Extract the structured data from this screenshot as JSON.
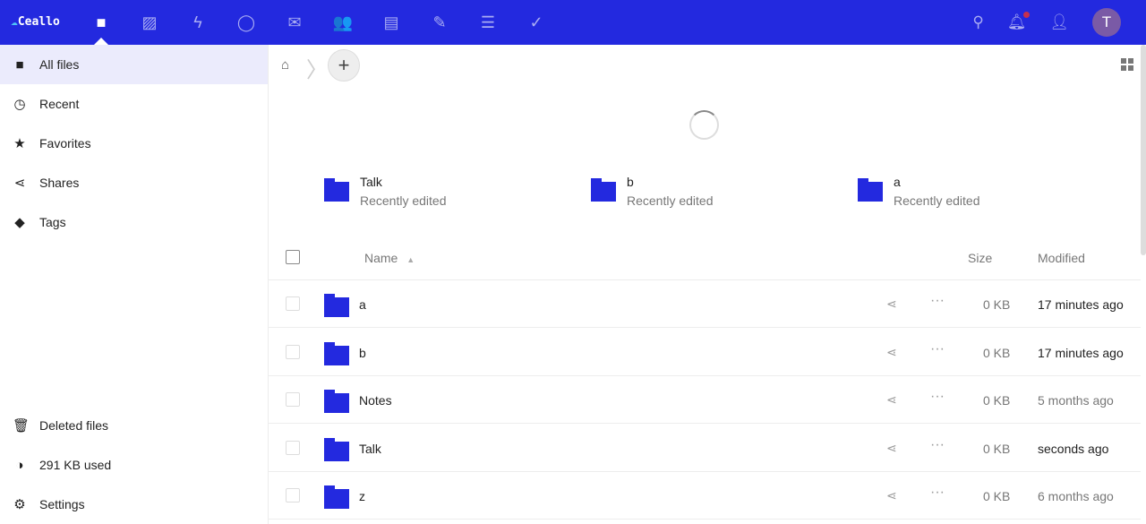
{
  "header": {
    "logo": "Ceallo",
    "apps": [
      {
        "icon": "files-icon",
        "glyph": "■",
        "active": true
      },
      {
        "icon": "photos-icon",
        "glyph": "▨"
      },
      {
        "icon": "activity-icon",
        "glyph": "ϟ"
      },
      {
        "icon": "talk-icon",
        "glyph": "◯"
      },
      {
        "icon": "mail-icon",
        "glyph": "✉"
      },
      {
        "icon": "contacts-icon",
        "glyph": "👥"
      },
      {
        "icon": "calendar-icon",
        "glyph": "▤"
      },
      {
        "icon": "notes-icon",
        "glyph": "✎"
      },
      {
        "icon": "deck-icon",
        "glyph": "☰"
      },
      {
        "icon": "tasks-icon",
        "glyph": "✓"
      }
    ],
    "avatar": "T",
    "accent": "#2329df"
  },
  "sidebar": {
    "items": [
      {
        "label": "All files",
        "glyph": "■",
        "icon": "folder-icon"
      },
      {
        "label": "Recent",
        "glyph": "◷",
        "icon": "clock-icon"
      },
      {
        "label": "Favorites",
        "glyph": "★",
        "icon": "star-icon"
      },
      {
        "label": "Shares",
        "glyph": "⋖",
        "icon": "share-icon"
      },
      {
        "label": "Tags",
        "glyph": "◆",
        "icon": "tag-icon"
      }
    ],
    "bottom": [
      {
        "label": "Deleted files",
        "glyph": "🗑",
        "icon": "trash-icon"
      },
      {
        "label": "291 KB used",
        "glyph": "◑",
        "icon": "quota-icon"
      },
      {
        "label": "Settings",
        "glyph": "⚙",
        "icon": "gear-icon"
      }
    ]
  },
  "recent": [
    {
      "name": "Talk",
      "sub": "Recently edited"
    },
    {
      "name": "b",
      "sub": "Recently edited"
    },
    {
      "name": "a",
      "sub": "Recently edited"
    }
  ],
  "table": {
    "name": "Name",
    "size": "Size",
    "modified": "Modified",
    "rows": [
      {
        "name": "a",
        "size": "0 KB",
        "modified": "17 minutes ago",
        "recent": true
      },
      {
        "name": "b",
        "size": "0 KB",
        "modified": "17 minutes ago",
        "recent": true
      },
      {
        "name": "Notes",
        "size": "0 KB",
        "modified": "5 months ago"
      },
      {
        "name": "Talk",
        "size": "0 KB",
        "modified": "seconds ago",
        "recent": true
      },
      {
        "name": "z",
        "size": "0 KB",
        "modified": "6 months ago"
      }
    ]
  }
}
